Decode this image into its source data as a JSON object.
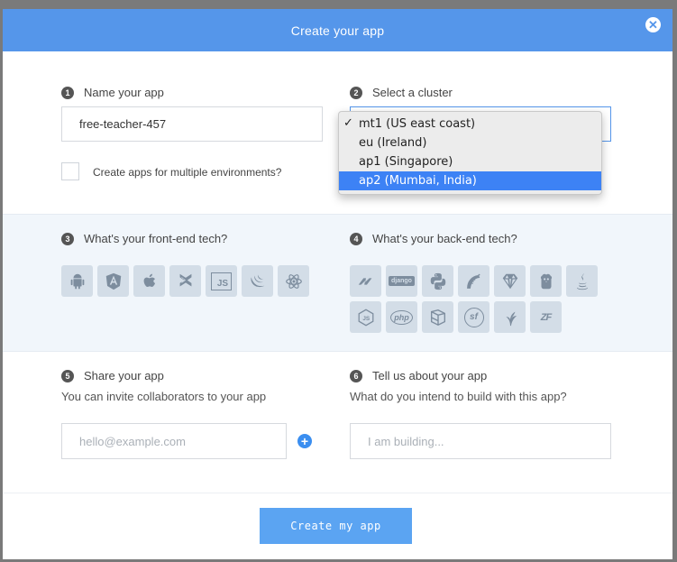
{
  "modal": {
    "title": "Create your app",
    "close_glyph": "✕"
  },
  "step1": {
    "number": "1",
    "label": "Name your app",
    "value": "free-teacher-457"
  },
  "checkbox": {
    "label": "Create apps for multiple environments?",
    "checked": false
  },
  "step2": {
    "number": "2",
    "label": "Select a cluster",
    "options": [
      {
        "label": "mt1 (US east coast)",
        "checked": true,
        "highlighted": false
      },
      {
        "label": "eu (Ireland)",
        "checked": false,
        "highlighted": false
      },
      {
        "label": "ap1 (Singapore)",
        "checked": false,
        "highlighted": false
      },
      {
        "label": "ap2 (Mumbai, India)",
        "checked": false,
        "highlighted": true
      }
    ],
    "check_glyph": "✓"
  },
  "step3": {
    "number": "3",
    "label": "What's your front-end tech?",
    "techs": [
      "android-icon",
      "angular-icon",
      "apple-icon",
      "backbone-icon",
      "javascript-icon",
      "jquery-icon",
      "react-icon"
    ],
    "js_text": "JS"
  },
  "step4": {
    "number": "4",
    "label": "What's your back-end tech?",
    "techs": [
      "dotnet-icon",
      "django-icon",
      "python-icon",
      "rails-icon",
      "ruby-icon",
      "go-icon",
      "java-icon",
      "nodejs-icon",
      "php-icon",
      "laravel-icon",
      "symfony-icon",
      "cakephp-icon",
      "zend-icon"
    ],
    "django_text": "django",
    "php_text": "php",
    "zf_text": "ZF",
    "sf_text": "sf"
  },
  "step5": {
    "number": "5",
    "label": "Share your app",
    "subtext": "You can invite collaborators to your app",
    "placeholder": "hello@example.com",
    "plus_glyph": "+"
  },
  "step6": {
    "number": "6",
    "label": "Tell us about your app",
    "subtext": "What do you intend to build with this app?",
    "placeholder": "I am building..."
  },
  "footer": {
    "submit_label": "Create my app"
  },
  "colors": {
    "header": "#5596ea",
    "accent": "#3d82f5",
    "tile_bg": "#d3dde7",
    "button": "#5ba4f2"
  }
}
